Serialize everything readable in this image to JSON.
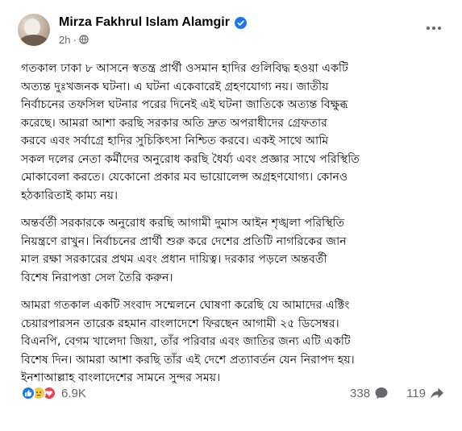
{
  "post": {
    "author": "Mirza Fakhrul Islam Alamgir",
    "time": "2h",
    "paragraphs": [
      "গতকাল ঢাকা ৮ আসনে স্বতন্ত্র প্রার্থী ওসমান হাদির গুলিবিদ্ধ হওয়া একটি\nঅত্যন্ত দুঃখজনক ঘটনা। এ ঘটনা একেবারেই গ্রহণযোগ্য নয়। জাতীয়\nনির্বাচনের তফসিল ঘটনার পরের দিনেই এই ঘটনা জাতিকে অত্যন্ত বিক্ষুব্ধ\nকরেছে। আমরা আশা করছি সরকার অতি দ্রুত অপরাধীদের গ্রেফতার\nকরবে এবং সর্বাগ্রে হাদির সুচিকিৎসা নিশ্চিত করবে। একই সাথে আমি\nসকল দলের নেতা কর্মীদের অনুরোধ করছি ধৈর্য্য এবং প্রজ্ঞার সাথে পরিস্থিতি\nমোকাবেলা করতে। যেকোনো প্রকার মব ভায়োলেন্স অগ্রহণযোগ্য। কোনও\nহঠকারিতাই কাম্য নয়।",
      "অন্তর্বর্তী সরকারকে অনুরোধ করছি আগামী দুমাস আইন শৃঙ্খলা পরিস্থিতি\nনিয়ন্ত্রণে রাখুন। নির্বাচনের প্রার্থী শুরু করে দেশের প্রতিটি নাগরিকের জান\nমাল রক্ষা সরকারের প্রথম এবং প্রধান দায়িত্ব। দরকার পড়লে অন্তবর্তী\nবিশেষ নিরাপত্তা সেল তৈরি করুন।",
      "আমরা গতকাল একটি  সংবাদ সম্মেলনে  ঘোষণা করেছি যে আমাদের এক্টিং\nচেয়ারপারসন তারেক রহমান বাংলাদেশে ফিরছেন আগামী ২৫ ডিসেম্বর।\nবিএনপি, বেগম খালেদা জিয়া, তাঁর পরিবার এবং জাতির জন্য এটি একটি\nবিশেষ দিন। আমরা আশা করছি তাঁর এই দেশে প্রত্যাবর্তন যেন নিরাপদ হয়।\nইনশাআল্লাহ বাংলাদেশের সামনে সুন্দর সময়।"
    ],
    "reactions_count": "6.9K",
    "comments_count": "338",
    "shares_count": "119",
    "icons": [
      "verified-badge-icon",
      "globe-icon",
      "more-options-icon",
      "like-reaction-icon",
      "sad-reaction-icon",
      "love-reaction-icon",
      "comment-icon",
      "share-icon"
    ],
    "colors": {
      "verified": "#1877f2",
      "secondary_text": "#65676b",
      "like": "#1877f2",
      "love": "#f33e58",
      "sad": "#f7c94a"
    }
  }
}
